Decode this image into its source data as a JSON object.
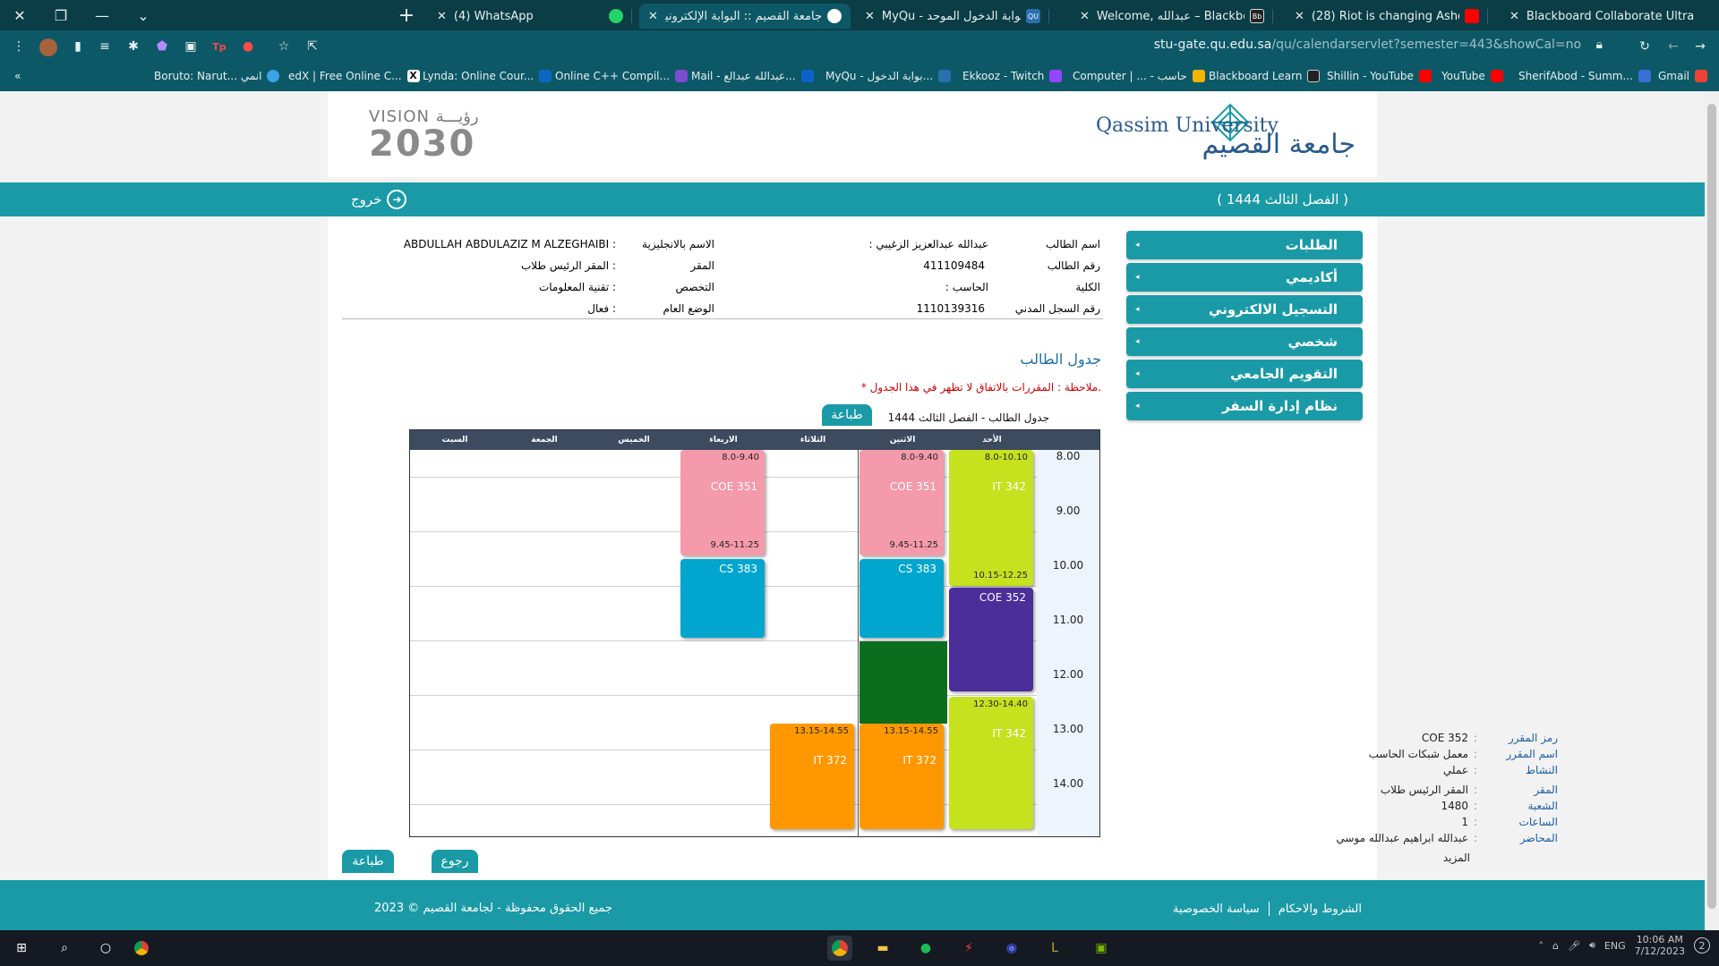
{
  "browser": {
    "tabs": [
      {
        "title": "(4) WhatsApp",
        "fav_color": "#25d366"
      },
      {
        "title": "جامعة القصيم :: البوابة الإلكترونية ل",
        "fav_color": "#ffffff"
      },
      {
        "title": "MyQu - بوابة الدخول الموحد |",
        "fav_color": "#2a6fb0",
        "fav_text": "QU"
      },
      {
        "title": "Welcome, عبدالله – Blackboard Le",
        "fav_color": "#222222",
        "fav_text": "Bb"
      },
      {
        "title": "(28) Riot is changing Ashe (finally",
        "fav_color": "#ff0000"
      },
      {
        "title": "Blackboard Collaborate Ultra – IT",
        "fav_color": "#222222"
      }
    ],
    "url_host": "stu-gate.qu.edu.sa",
    "url_path": "/qu/calendarservlet?semester=443&showCal=no",
    "bookmarks": [
      {
        "label": "Boruto: Narut... انمي",
        "color": "#3ba3e6"
      },
      {
        "label": "edX | Free Online C...",
        "color": "#111111"
      },
      {
        "label": "Lynda: Online Cour...",
        "color": "#0a66c2"
      },
      {
        "label": "Online C++ Compil...",
        "color": "#7b4bd1"
      },
      {
        "label": "Mail - عبدالله عبدالع...",
        "color": "#0a64c8"
      },
      {
        "label": "MyQu - بوابة الدخول...",
        "color": "#2a6fb0"
      },
      {
        "label": "Ekkooz - Twitch",
        "color": "#9146ff"
      },
      {
        "label": "Computer | ... - حاسب",
        "color": "#f4b400"
      },
      {
        "label": "Blackboard Learn",
        "color": "#222222"
      },
      {
        "label": "Shillin - YouTube",
        "color": "#ff0000"
      },
      {
        "label": "YouTube",
        "color": "#ff0000"
      },
      {
        "label": "SherifAbod - Summ...",
        "color": "#3a6fd8"
      },
      {
        "label": "Gmail",
        "color": "#ea4335"
      }
    ]
  },
  "header": {
    "vision_label": "VISION رؤيـــة",
    "vision_year": "2030",
    "logo_en": "Qassim University",
    "logo_ar": "جامعة القصيم"
  },
  "bar": {
    "semester": "( الفصل الثالث 1444 )",
    "logout": "خروج"
  },
  "menu": [
    "الطلبات",
    "أكاديمي",
    "التسجيل الالكتروني",
    "شخصي",
    "التقويم الجامعي",
    "نظام إدارة السفر"
  ],
  "student": {
    "name_label": "اسم الطالب",
    "name_value": ": عبدالله عبدالعزيز الزغيبي",
    "id_label": "رقم الطالب",
    "id_value": "411109484",
    "college_label": "الكلية",
    "college_value": ": الحاسب",
    "civil_label": "رقم السجل المدني",
    "civil_value": "1110139316",
    "en_name_label": "الاسم بالانجليزية",
    "en_name_value": "ABDULLAH ABDULAZIZ M ALZEGHAIBI :",
    "location_label": "المقر",
    "location_value": "المقر الرئيس طلاب :",
    "major_label": "التخصص",
    "major_value": "تقنية المعلومات :",
    "status_label": "الوضع العام",
    "status_value": "فعال :"
  },
  "schedule": {
    "title": "جدول الطالب",
    "note": "* ملاحظة : المقررات بالاتفاق لا تظهر في هذا الجدول.",
    "print_label": "طباعة",
    "caption": "جدول الطالب  -  الفصل الثالث 1444",
    "days": [
      "الأحد",
      "الاثنين",
      "الثلاثاء",
      "الاربعاء",
      "الخميس",
      "الجمعة",
      "السبت"
    ],
    "times": [
      "8.00",
      "9.00",
      "10.00",
      "11.00",
      "12.00",
      "13.00",
      "14.00"
    ],
    "courses": [
      {
        "code": "IT 342",
        "start": "8.0-10.10",
        "end": "10.15-12.25",
        "color": "#c6e11e"
      },
      {
        "code": "COE 351",
        "start": "8.0-9.40",
        "end": "9.45-11.25",
        "color": "#f49aab"
      },
      {
        "code": "COE 351",
        "start": "8.0-9.40",
        "end": "9.45-11.25",
        "color": "#f49aab"
      },
      {
        "code": "CS 383",
        "color": "#00a6ce"
      },
      {
        "code": "CS 383",
        "color": "#00a6ce"
      },
      {
        "code": "COE 352",
        "color": "#4b2e9a"
      },
      {
        "code": "IT 342",
        "start": "12.30-14.40",
        "color": "#c6e11e"
      },
      {
        "code": "IT 372",
        "start": "13.15-14.55",
        "color": "#ff9800"
      },
      {
        "code": "IT 372",
        "start": "13.15-14.55",
        "color": "#ff9800"
      }
    ]
  },
  "details": {
    "code_label": "رمز المقرر",
    "code_value": "COE 352",
    "name_label": "اسم المقرر",
    "name_value": "معمل شبكات الحاسب",
    "activity_label": "النشاط",
    "activity_value": "عملي",
    "location_label": "المقر",
    "location_value": "المقر الرئيس طلاب",
    "section_label": "الشعبة",
    "section_value": "1480",
    "hours_label": "الساعات",
    "hours_value": "1",
    "lecturer_label": "المحاضر",
    "lecturer_value": "عبدالله ابراهيم عبدالله موسي",
    "more": "المزيد"
  },
  "buttons": {
    "back": "رجوع",
    "print": "طباعة"
  },
  "footer": {
    "copyright": "جميع الحقوق محفوظة - لجامعة القصيم © 2023",
    "terms": "الشروط والاحكام",
    "privacy": "سياسة الخصوصية"
  },
  "taskbar": {
    "time": "10:06 AM",
    "date": "7/12/2023",
    "lang": "ENG",
    "notifications": "2"
  }
}
